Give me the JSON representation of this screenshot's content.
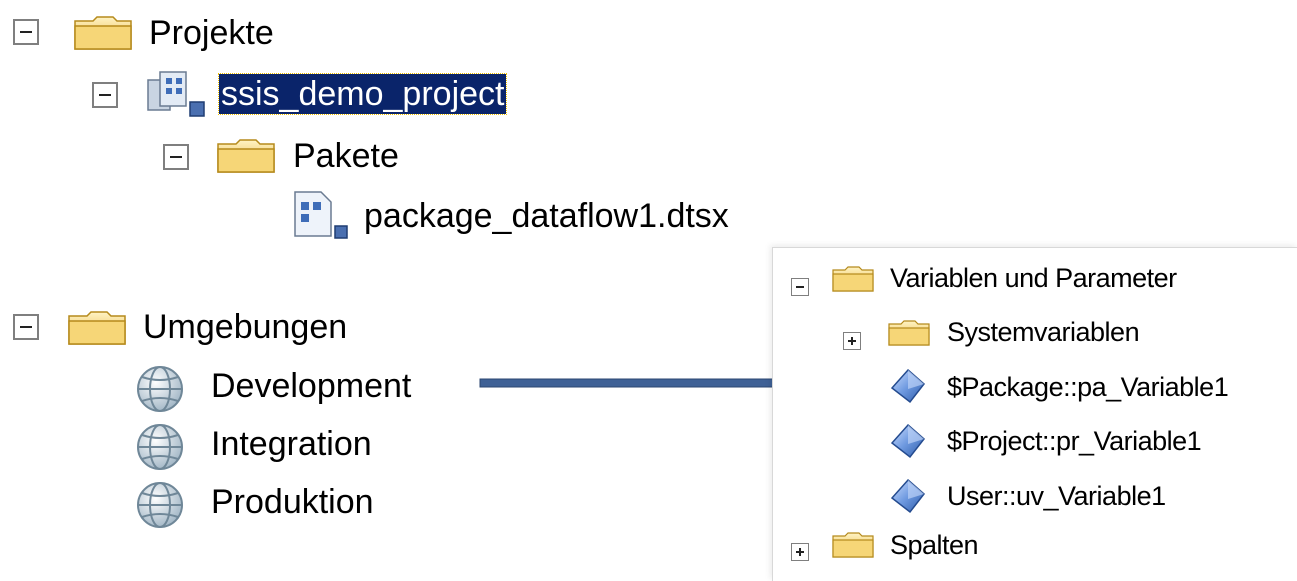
{
  "tree": {
    "projekte": {
      "label": "Projekte"
    },
    "project": {
      "label": "ssis_demo_project"
    },
    "pakete": {
      "label": "Pakete"
    },
    "package": {
      "label": "package_dataflow1.dtsx"
    },
    "umgebungen": {
      "label": "Umgebungen"
    },
    "environments": [
      {
        "label": "Development"
      },
      {
        "label": "Integration"
      },
      {
        "label": "Produktion"
      }
    ]
  },
  "panel": {
    "root": {
      "label": "Variablen und Parameter"
    },
    "system": {
      "label": "Systemvariablen"
    },
    "variables": [
      {
        "label": "$Package::pa_Variable1"
      },
      {
        "label": "$Project::pr_Variable1"
      },
      {
        "label": "User::uv_Variable1"
      }
    ],
    "spalten": {
      "label": "Spalten"
    }
  },
  "colors": {
    "selection": "#0a246a",
    "folder": "#f3cf5c",
    "arrow": "#3f6196",
    "variable": "#5f8fd8"
  }
}
